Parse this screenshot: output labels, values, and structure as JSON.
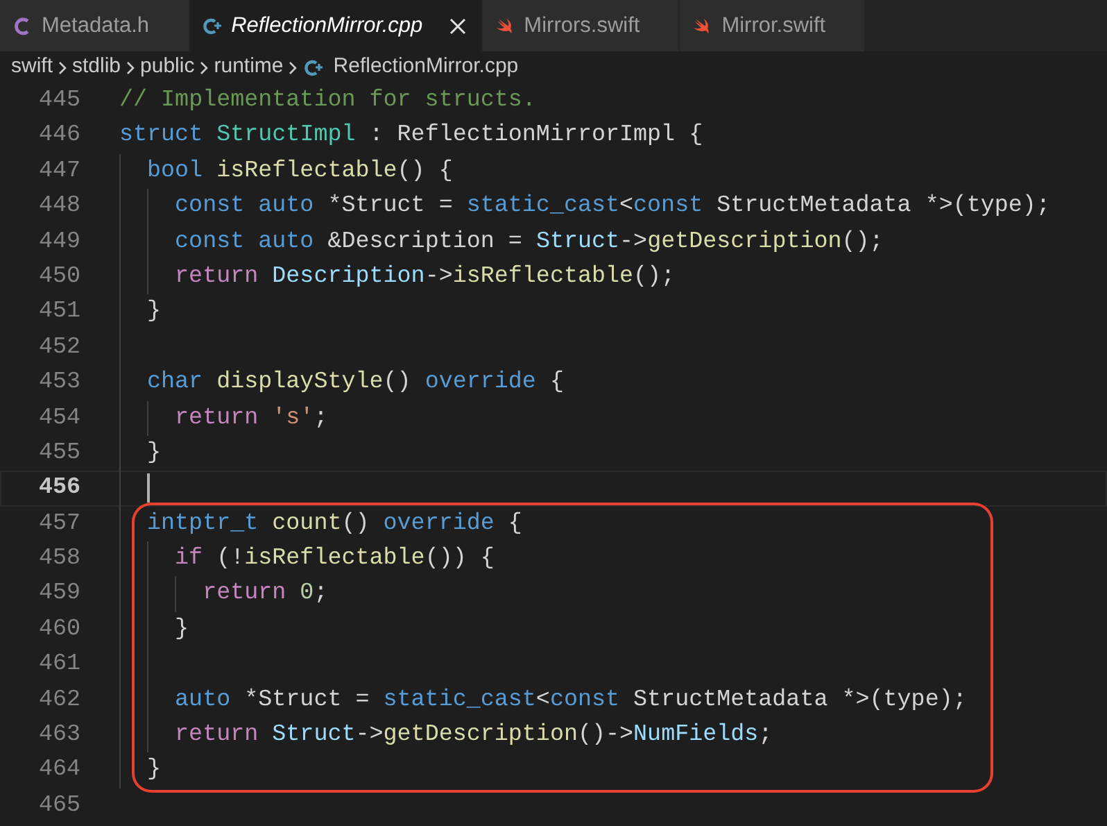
{
  "tabs": [
    {
      "label": "Metadata.h",
      "kind": "c",
      "selected": false
    },
    {
      "label": "ReflectionMirror.cpp",
      "kind": "cpp",
      "selected": true
    },
    {
      "label": "Mirrors.swift",
      "kind": "swift",
      "selected": false
    },
    {
      "label": "Mirror.swift",
      "kind": "swift",
      "selected": false
    }
  ],
  "breadcrumb": [
    {
      "label": "swift",
      "kind": "folder"
    },
    {
      "label": "stdlib",
      "kind": "folder"
    },
    {
      "label": "public",
      "kind": "folder"
    },
    {
      "label": "runtime",
      "kind": "folder"
    },
    {
      "label": "ReflectionMirror.cpp",
      "kind": "cpp"
    }
  ],
  "lines": [
    {
      "number": "445",
      "current": false,
      "highlighted": false,
      "tokens": [
        {
          "text": "// Implementation for structs.",
          "kind": "comment"
        }
      ]
    },
    {
      "number": "446",
      "current": false,
      "highlighted": false,
      "tokens": [
        {
          "text": "struct",
          "kind": "keyword"
        },
        {
          "text": " StructImpl",
          "kind": "type"
        },
        {
          "text": " : ReflectionMirrorImpl {",
          "kind": "plain"
        }
      ]
    },
    {
      "number": "447",
      "current": false,
      "highlighted": false,
      "tokens": [
        {
          "text": "  bool",
          "kind": "keyword"
        },
        {
          "text": " isReflectable",
          "kind": "function"
        },
        {
          "text": "() {",
          "kind": "plain"
        }
      ]
    },
    {
      "number": "448",
      "current": false,
      "highlighted": false,
      "tokens": [
        {
          "text": "    const",
          "kind": "keyword"
        },
        {
          "text": " auto",
          "kind": "keyword"
        },
        {
          "text": " *Struct = ",
          "kind": "plain"
        },
        {
          "text": "static_cast",
          "kind": "keyword"
        },
        {
          "text": "<",
          "kind": "plain"
        },
        {
          "text": "const",
          "kind": "keyword"
        },
        {
          "text": " StructMetadata *>(type);",
          "kind": "plain"
        }
      ]
    },
    {
      "number": "449",
      "current": false,
      "highlighted": false,
      "tokens": [
        {
          "text": "    const",
          "kind": "keyword"
        },
        {
          "text": " auto",
          "kind": "keyword"
        },
        {
          "text": " &Description = ",
          "kind": "plain"
        },
        {
          "text": "Struct",
          "kind": "variable"
        },
        {
          "text": "->",
          "kind": "plain"
        },
        {
          "text": "getDescription",
          "kind": "function"
        },
        {
          "text": "();",
          "kind": "plain"
        }
      ]
    },
    {
      "number": "450",
      "current": false,
      "highlighted": false,
      "tokens": [
        {
          "text": "    return",
          "kind": "control"
        },
        {
          "text": " Description",
          "kind": "variable"
        },
        {
          "text": "->",
          "kind": "plain"
        },
        {
          "text": "isReflectable",
          "kind": "function"
        },
        {
          "text": "();",
          "kind": "plain"
        }
      ]
    },
    {
      "number": "451",
      "current": false,
      "highlighted": false,
      "tokens": [
        {
          "text": "  }",
          "kind": "plain"
        }
      ]
    },
    {
      "number": "452",
      "current": false,
      "highlighted": false
    },
    {
      "number": "453",
      "current": false,
      "highlighted": false,
      "tokens": [
        {
          "text": "  char",
          "kind": "keyword"
        },
        {
          "text": " displayStyle",
          "kind": "function"
        },
        {
          "text": "() ",
          "kind": "plain"
        },
        {
          "text": "override",
          "kind": "keyword"
        },
        {
          "text": " {",
          "kind": "plain"
        }
      ]
    },
    {
      "number": "454",
      "current": false,
      "highlighted": false,
      "tokens": [
        {
          "text": "    return",
          "kind": "control"
        },
        {
          "text": " 's'",
          "kind": "string"
        },
        {
          "text": ";",
          "kind": "plain"
        }
      ]
    },
    {
      "number": "455",
      "current": false,
      "highlighted": false,
      "tokens": [
        {
          "text": "  }",
          "kind": "plain"
        }
      ]
    },
    {
      "number": "456",
      "current": true,
      "highlighted": false
    },
    {
      "number": "457",
      "current": false,
      "highlighted": true,
      "tokens": [
        {
          "text": "  intptr_t",
          "kind": "keyword"
        },
        {
          "text": " count",
          "kind": "function"
        },
        {
          "text": "() ",
          "kind": "plain"
        },
        {
          "text": "override",
          "kind": "keyword"
        },
        {
          "text": " {",
          "kind": "plain"
        }
      ]
    },
    {
      "number": "458",
      "current": false,
      "highlighted": true,
      "tokens": [
        {
          "text": "    if",
          "kind": "control"
        },
        {
          "text": " (!",
          "kind": "plain"
        },
        {
          "text": "isReflectable",
          "kind": "function"
        },
        {
          "text": "()) {",
          "kind": "plain"
        }
      ]
    },
    {
      "number": "459",
      "current": false,
      "highlighted": true,
      "tokens": [
        {
          "text": "      return",
          "kind": "control"
        },
        {
          "text": " 0",
          "kind": "number"
        },
        {
          "text": ";",
          "kind": "plain"
        }
      ]
    },
    {
      "number": "460",
      "current": false,
      "highlighted": true,
      "tokens": [
        {
          "text": "    }",
          "kind": "plain"
        }
      ]
    },
    {
      "number": "461",
      "current": false,
      "highlighted": true
    },
    {
      "number": "462",
      "current": false,
      "highlighted": true,
      "tokens": [
        {
          "text": "    auto",
          "kind": "keyword"
        },
        {
          "text": " *Struct = ",
          "kind": "plain"
        },
        {
          "text": "static_cast",
          "kind": "keyword"
        },
        {
          "text": "<",
          "kind": "plain"
        },
        {
          "text": "const",
          "kind": "keyword"
        },
        {
          "text": " StructMetadata *>(type);",
          "kind": "plain"
        }
      ]
    },
    {
      "number": "463",
      "current": false,
      "highlighted": true,
      "tokens": [
        {
          "text": "    return",
          "kind": "control"
        },
        {
          "text": " Struct",
          "kind": "variable"
        },
        {
          "text": "->",
          "kind": "plain"
        },
        {
          "text": "getDescription",
          "kind": "function"
        },
        {
          "text": "()->",
          "kind": "plain"
        },
        {
          "text": "NumFields",
          "kind": "variable"
        },
        {
          "text": ";",
          "kind": "plain"
        }
      ]
    },
    {
      "number": "464",
      "current": false,
      "highlighted": true,
      "tokens": [
        {
          "text": "  }",
          "kind": "plain"
        }
      ]
    },
    {
      "number": "465",
      "current": false,
      "highlighted": false
    }
  ]
}
